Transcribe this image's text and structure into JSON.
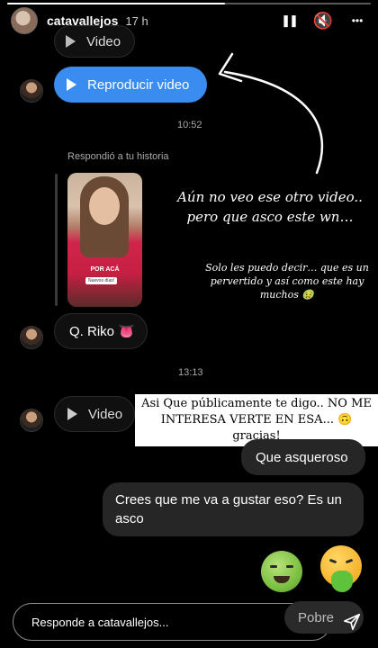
{
  "story": {
    "username": "catavallejos",
    "time_ago": "17 h",
    "progress_fraction": 0.6,
    "controls": {
      "pause": "❚❚",
      "mute": "🔇",
      "more": "•••"
    }
  },
  "chat": {
    "top_video_label": "Video",
    "play_video_label": "Reproducir video",
    "timestamp_1": "10:52",
    "replied_label": "Respondió a tu historia",
    "thumb_caption": "POR ACÁ",
    "thumb_caption2": "Nuevos días!",
    "reply_message": "Q. Riko 👅",
    "timestamp_2": "13:13",
    "video_label": "Video",
    "sent_1": "Que asqueroso",
    "sent_2": "Crees que me va a gustar eso? Es un asco",
    "reaction_1": "🤢",
    "reaction_2": "🤮"
  },
  "overlay": {
    "big_text": "Aún no veo ese otro video.. pero que asco este wn…",
    "small_text": "Solo les puedo decir… que es un pervertido y así como este hay muchos 🤢",
    "note_text": "Asi Que públicamente te digo.. NO ME INTERESA VERTE EN ESA... 🙃gracias!"
  },
  "composer": {
    "placeholder": "Responde a catavallejos...",
    "suggestion": "Pobre",
    "send_icon": "paper-plane"
  },
  "colors": {
    "accent_blue": "#3a8df0",
    "bubble_grey": "#262626"
  }
}
